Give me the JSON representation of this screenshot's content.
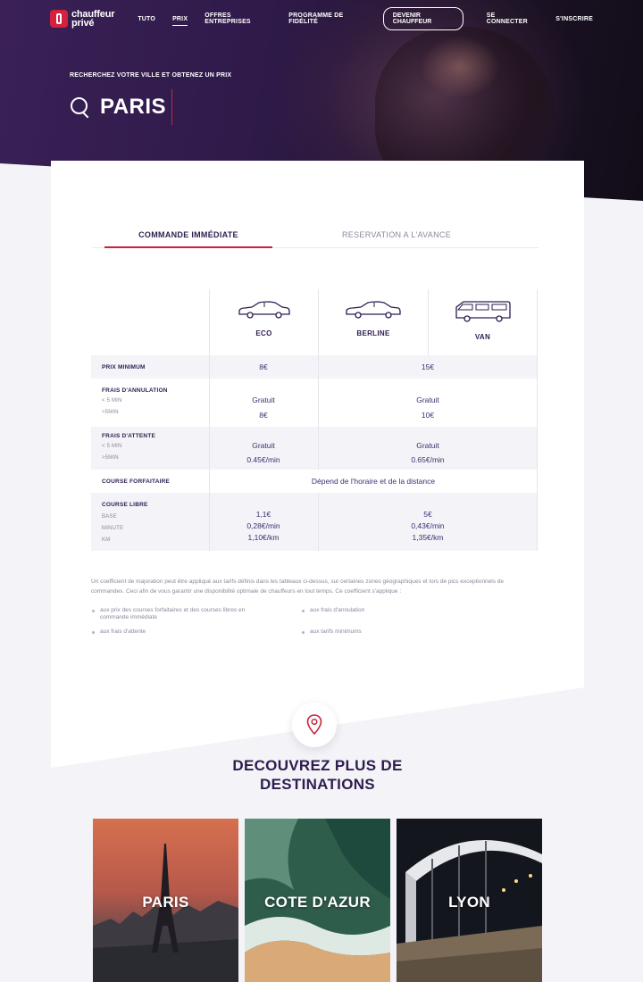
{
  "brand": {
    "line1": "chauffeur",
    "line2": "privé"
  },
  "nav": {
    "links": [
      "TUTO",
      "PRIX",
      "OFFRES ENTREPRISES",
      "PROGRAMME DE FIDÉLITÉ"
    ],
    "cta": "DEVENIR CHAUFFEUR",
    "login": "SE CONNECTER",
    "signup": "S'INSCRIRE"
  },
  "hero": {
    "subtitle": "RECHERCHEZ VOTRE VILLE ET OBTENEZ UN PRIX",
    "city": "PARIS"
  },
  "tabs": [
    "COMMANDE IMMÉDIATE",
    "RESERVATION A L'AVANCE"
  ],
  "vehicles": [
    "ECO",
    "BERLINE",
    "VAN"
  ],
  "table": {
    "min_price": {
      "label": "PRIX MINIMUM",
      "eco": "8€",
      "rest": "15€"
    },
    "cancel": {
      "label": "FRAIS D'ANNULATION",
      "sub1": "< 5 MIN",
      "sub2": ">5MIN",
      "eco1": "Gratuit",
      "eco2": "8€",
      "rest1": "Gratuit",
      "rest2": "10€"
    },
    "wait": {
      "label": "FRAIS D'ATTENTE",
      "sub1": "< 5 MIN",
      "sub2": ">5MIN",
      "eco1": "Gratuit",
      "eco2": "0.45€/min",
      "rest1": "Gratuit",
      "rest2": "0.65€/min"
    },
    "flat": {
      "label": "COURSE FORFAITAIRE",
      "value": "Dépend de l'horaire et de la distance"
    },
    "free": {
      "label": "COURSE LIBRE",
      "sub1": "BASE",
      "sub2": "MINUTE",
      "sub3": "KM",
      "eco1": "1,1€",
      "eco2": "0,28€/min",
      "eco3": "1,10€/km",
      "rest1": "5€",
      "rest2": "0,43€/min",
      "rest3": "1,35€/km"
    }
  },
  "note": "Un coefficient de majoration peut être appliqué aux tarifs définis dans les tableaux ci-dessus, sur certaines zones géographiques et lors de pics exceptionnels de commandes. Ceci afin de vous garantir une disponibilité optimale de chauffeurs en tout temps. Ce coefficient s'applique :",
  "bullets": [
    "aux prix des courses forfaitaires et des courses libres en commande immédiate",
    "aux frais d'annulation",
    "aux frais d'attente",
    "aux tarifs minimums"
  ],
  "destinations": {
    "title_line1": "DECOUVREZ PLUS DE",
    "title_line2": "DESTINATIONS",
    "items": [
      "PARIS",
      "COTE D'AZUR",
      "LYON"
    ]
  },
  "colors": {
    "accent": "#c8243f",
    "navy": "#2d1d4f",
    "hero": "#3a2056"
  }
}
